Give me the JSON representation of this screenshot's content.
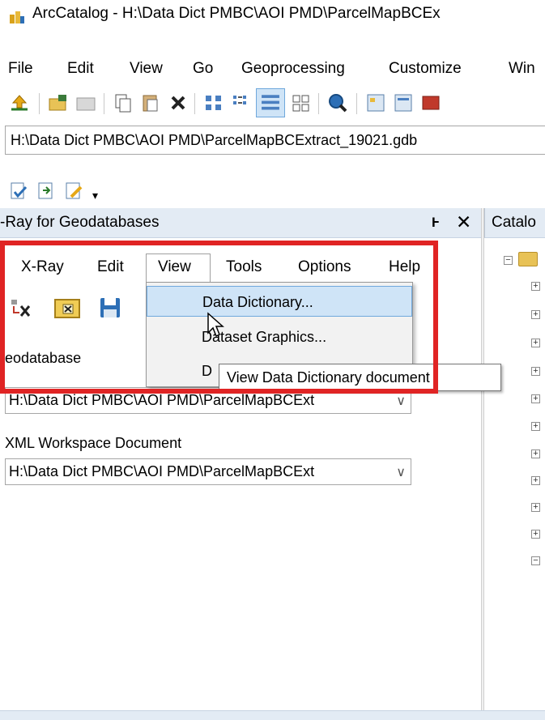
{
  "window": {
    "title": "ArcCatalog - H:\\Data Dict PMBC\\AOI PMD\\ParcelMapBCEx"
  },
  "menubar": {
    "items": [
      "File",
      "Edit",
      "View",
      "Go",
      "Geoprocessing",
      "Customize",
      "Win"
    ]
  },
  "location": {
    "path": "H:\\Data Dict PMBC\\AOI PMD\\ParcelMapBCExtract_19021.gdb"
  },
  "xray_panel": {
    "title": "-Ray for Geodatabases",
    "menu": [
      "X-Ray",
      "Edit",
      "View",
      "Tools",
      "Options",
      "Help"
    ],
    "geodatabase_label": "eodatabase",
    "geodatabase_value": "H:\\Data Dict PMBC\\AOI PMD\\ParcelMapBCExt",
    "xml_label": "XML Workspace Document",
    "xml_value": "H:\\Data Dict PMBC\\AOI PMD\\ParcelMapBCExt"
  },
  "view_menu": {
    "items": [
      "Data Dictionary...",
      "Dataset Graphics...",
      "D"
    ]
  },
  "tooltip": {
    "text": "View Data Dictionary document"
  },
  "catalog_panel": {
    "title": "Catalo"
  },
  "colors": {
    "panel_header": "#e3ebf4",
    "highlight": "#cfe4f7",
    "annotation_red": "#e02424"
  }
}
